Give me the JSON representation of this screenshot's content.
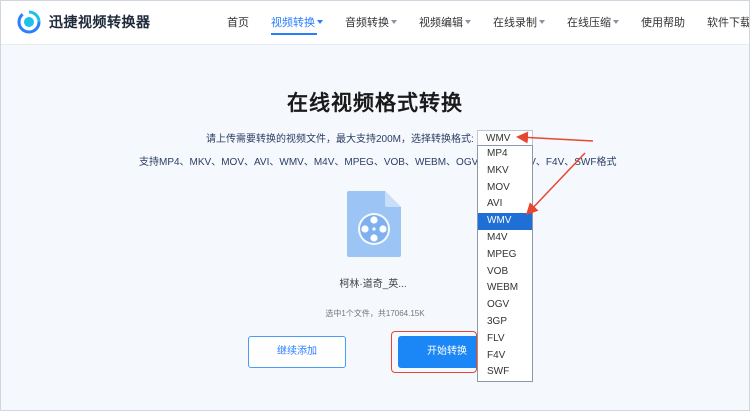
{
  "app": {
    "logo_text": "迅捷视频转换器",
    "brand_color": "#2a7fff"
  },
  "nav": {
    "items": [
      {
        "label": "首页",
        "active": false,
        "has_caret": false
      },
      {
        "label": "视频转换",
        "active": true,
        "has_caret": true
      },
      {
        "label": "音频转换",
        "active": false,
        "has_caret": true
      },
      {
        "label": "视频编辑",
        "active": false,
        "has_caret": true
      },
      {
        "label": "在线录制",
        "active": false,
        "has_caret": true
      },
      {
        "label": "在线压缩",
        "active": false,
        "has_caret": true
      },
      {
        "label": "使用帮助",
        "active": false,
        "has_caret": false
      },
      {
        "label": "软件下载",
        "active": false,
        "has_caret": false
      }
    ]
  },
  "main": {
    "title": "在线视频格式转换",
    "description": "请上传需要转换的视频文件，最大支持200M，选择转换格式:",
    "supported_formats": "支持MP4、MKV、MOV、AVI、WMV、M4V、MPEG、VOB、WEBM、OGV、3GP、FLV、F4V、SWF格式",
    "format_select": {
      "value": "WMV",
      "options": [
        "MP4",
        "MKV",
        "MOV",
        "AVI",
        "WMV",
        "M4V",
        "MPEG",
        "VOB",
        "WEBM",
        "OGV",
        "3GP",
        "FLV",
        "F4V",
        "SWF"
      ],
      "highlighted": "WMV"
    },
    "file": {
      "name": "柯林·道奇_英...",
      "icon": "video-file-icon"
    },
    "summary": "选中1个文件，共17064.15K",
    "buttons": {
      "add_label": "继续添加",
      "start_label": "开始转换"
    },
    "annotation_color": "#e8472f"
  }
}
